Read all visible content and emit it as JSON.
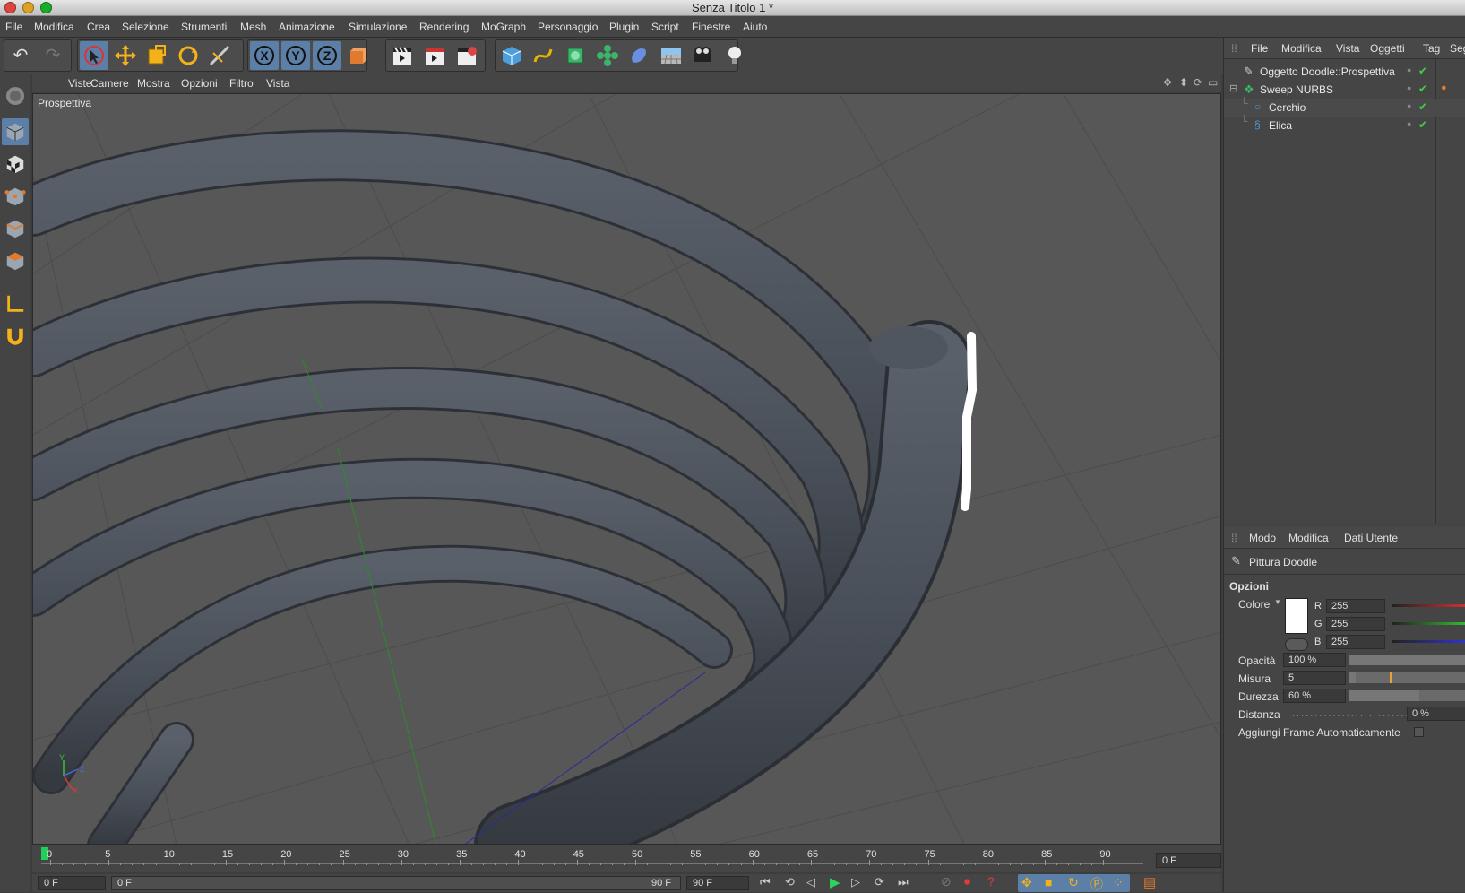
{
  "window": {
    "title": "Senza Titolo 1 *"
  },
  "menubar": [
    "File",
    "Modifica",
    "Crea",
    "Selezione",
    "Strumenti",
    "Mesh",
    "Animazione",
    "Simulazione",
    "Rendering",
    "MoGraph",
    "Personaggio",
    "Plugin",
    "Script",
    "Finestre",
    "Aiuto"
  ],
  "viewport": {
    "menu": [
      "Viste",
      "Camere",
      "Mostra",
      "Opzioni",
      "Filtro",
      "Vista"
    ],
    "label": "Prospettiva",
    "axes": {
      "y": "Y",
      "z": "Z",
      "x": "X"
    }
  },
  "timeline": {
    "ticks": [
      "0",
      "5",
      "10",
      "15",
      "20",
      "25",
      "30",
      "35",
      "40",
      "45",
      "50",
      "55",
      "60",
      "65",
      "70",
      "75",
      "80",
      "85",
      "90"
    ],
    "current_frame": "0 F",
    "start_field": "0 F",
    "range_start": "0 F",
    "range_end": "90 F",
    "end_field": "90 F"
  },
  "object_manager": {
    "menu": [
      "File",
      "Modifica",
      "Vista",
      "Oggetti",
      "Tag",
      "Seg"
    ],
    "objects": [
      {
        "name": "Oggetto Doodle::Prospettiva",
        "indent": 0
      },
      {
        "name": "Sweep NURBS",
        "indent": 0
      },
      {
        "name": "Cerchio",
        "indent": 1
      },
      {
        "name": "Elica",
        "indent": 1
      }
    ]
  },
  "attributes": {
    "menu": [
      "Modo",
      "Modifica",
      "Dati Utente"
    ],
    "tool_name": "Pittura Doodle",
    "section": "Opzioni",
    "color_label": "Colore",
    "r_label": "R",
    "r": "255",
    "g_label": "G",
    "g": "255",
    "b_label": "B",
    "b": "255",
    "opacity_label": "Opacità",
    "opacity": "100 %",
    "opacity_level": 1.0,
    "size_label": "Misura",
    "size": "5",
    "size_level": 0.05,
    "hardness_label": "Durezza",
    "hardness": "60 %",
    "hardness_level": 0.6,
    "distance_label": "Distanza",
    "distance": "0 %",
    "autoframe_label": "Aggiungi Frame Automaticamente"
  },
  "colors": {
    "accent": "#5b7fa6",
    "tube": "#4a4f57",
    "viewport_bg": "#575757"
  }
}
